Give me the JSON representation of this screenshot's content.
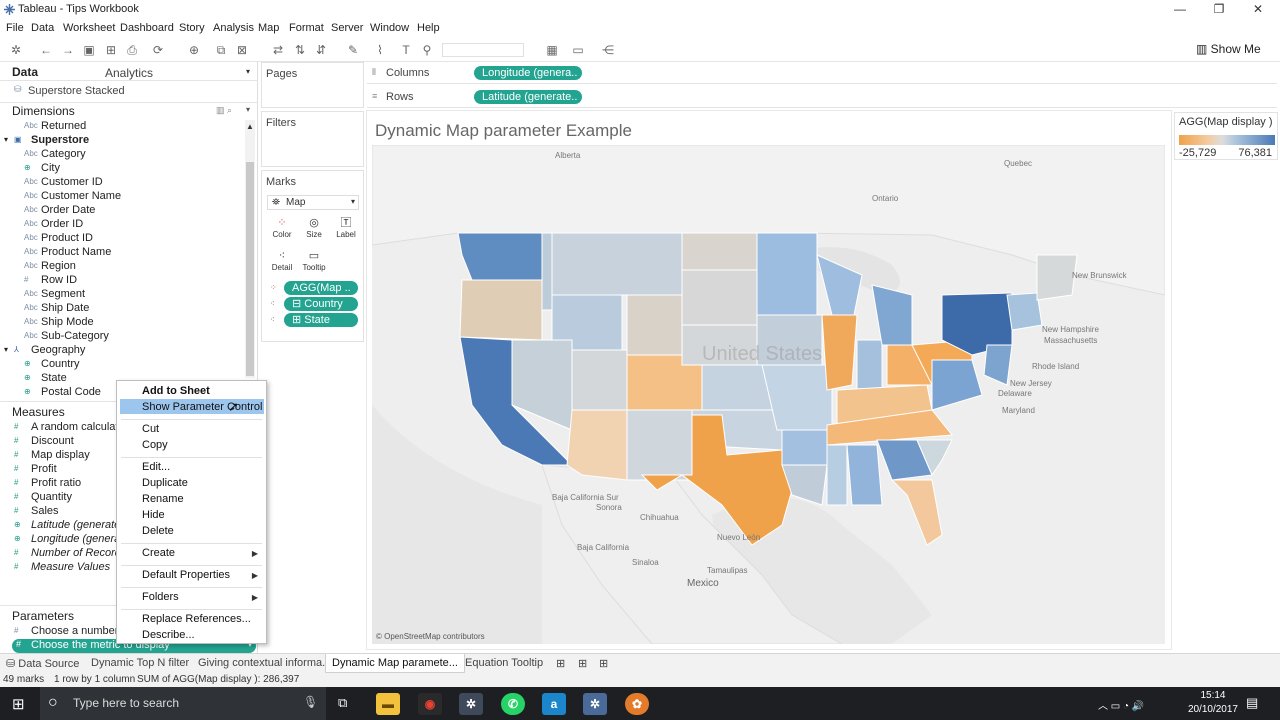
{
  "window": {
    "title": "Tableau - Tips Workbook",
    "controls": [
      "—",
      "❐",
      "✕"
    ]
  },
  "menu": [
    "File",
    "Data",
    "Worksheet",
    "Dashboard",
    "Story",
    "Analysis",
    "Map",
    "Format",
    "Server",
    "Window",
    "Help"
  ],
  "toolbar": {
    "show_me": "Show Me"
  },
  "data_pane": {
    "tabs": [
      "Data",
      "Analytics"
    ],
    "datasource": "Superstore Stacked",
    "dimensions_label": "Dimensions",
    "dimensions": [
      {
        "type": "Abc",
        "name": "Returned",
        "geo": false
      },
      {
        "type": "folder",
        "name": "Superstore",
        "geo": false
      },
      {
        "type": "Abc",
        "name": "Category",
        "geo": false
      },
      {
        "type": "geo",
        "name": "City",
        "geo": true
      },
      {
        "type": "Abc",
        "name": "Customer ID",
        "geo": false
      },
      {
        "type": "Abc",
        "name": "Customer Name",
        "geo": false
      },
      {
        "type": "Abc",
        "name": "Order Date",
        "geo": false
      },
      {
        "type": "Abc",
        "name": "Order ID",
        "geo": false
      },
      {
        "type": "Abc",
        "name": "Product ID",
        "geo": false
      },
      {
        "type": "Abc",
        "name": "Product Name",
        "geo": false
      },
      {
        "type": "Abc",
        "name": "Region",
        "geo": false
      },
      {
        "type": "#",
        "name": "Row ID",
        "geo": false
      },
      {
        "type": "Abc",
        "name": "Segment",
        "geo": false
      },
      {
        "type": "Abc",
        "name": "Ship Date",
        "geo": false
      },
      {
        "type": "Abc",
        "name": "Ship Mode",
        "geo": false
      },
      {
        "type": "Abc",
        "name": "Sub-Category",
        "geo": false
      },
      {
        "type": "hier",
        "name": "Geography",
        "geo": false
      },
      {
        "type": "geo",
        "name": "Country",
        "geo": true
      },
      {
        "type": "geo",
        "name": "State",
        "geo": true
      },
      {
        "type": "geo",
        "name": "Postal Code",
        "geo": true
      }
    ],
    "measures_label": "Measures",
    "measures": [
      {
        "name": "A random calculati",
        "italic": false
      },
      {
        "name": "Discount",
        "italic": false
      },
      {
        "name": "Map display",
        "italic": false
      },
      {
        "name": "Profit",
        "italic": false
      },
      {
        "name": "Profit ratio",
        "italic": false
      },
      {
        "name": "Quantity",
        "italic": false
      },
      {
        "name": "Sales",
        "italic": false
      },
      {
        "name": "Latitude (generate",
        "italic": true
      },
      {
        "name": "Longitude (genera",
        "italic": true
      },
      {
        "name": "Number of Record",
        "italic": true
      },
      {
        "name": "Measure Values",
        "italic": true
      }
    ],
    "parameters_label": "Parameters",
    "parameters": [
      "Choose a number o",
      "Choose the metric to display"
    ]
  },
  "cards": {
    "pages": "Pages",
    "filters": "Filters",
    "marks": "Marks",
    "mark_type": "Map",
    "mark_buttons": [
      "Color",
      "Size",
      "Label",
      "Detail",
      "Tooltip"
    ],
    "mark_pills": [
      "AGG(Map ..",
      "Country",
      "State"
    ]
  },
  "shelves": {
    "columns_label": "Columns",
    "columns_pill": "Longitude (genera..",
    "rows_label": "Rows",
    "rows_pill": "Latitude (generate.."
  },
  "viz": {
    "title": "Dynamic Map parameter Example",
    "credit": "© OpenStreetMap contributors",
    "places": [
      "Alberta",
      "Quebec",
      "Ontario",
      "New Brunswick",
      "New Hampshire",
      "Massachusetts",
      "Rhode Island",
      "New Jersey",
      "Delaware",
      "Maryland",
      "United States",
      "Baja California Sur",
      "Sonora",
      "Chihuahua",
      "Baja California",
      "Mexico",
      "Tamaulipas",
      "Nuevo León",
      "Sinaloa"
    ]
  },
  "legend": {
    "title": "AGG(Map display )",
    "min": "-25,729",
    "max": "76,381"
  },
  "context_menu": {
    "items": [
      "Add to Sheet",
      "Show Parameter Control",
      "Cut",
      "Copy",
      "Edit...",
      "Duplicate",
      "Rename",
      "Hide",
      "Delete",
      "Create",
      "Default Properties",
      "Folders",
      "Replace References...",
      "Describe..."
    ],
    "highlighted": "Show Parameter Control"
  },
  "sheet_tabs": [
    "Data Source",
    "Dynamic Top N filter",
    "Giving contextual informa...",
    "Dynamic Map paramete...",
    "Equation Tooltip"
  ],
  "active_tab": "Dynamic Map paramete...",
  "status": {
    "marks": "49 marks",
    "rowscols": "1 row by 1 column",
    "sum": "SUM of AGG(Map display ): 286,397"
  },
  "taskbar": {
    "search_placeholder": "Type here to search",
    "time": "15:14",
    "date": "20/10/2017"
  },
  "colors": {
    "accent_pill": "#23a491",
    "low": "#f0a24a",
    "high": "#4a79b5",
    "highlight": "#9dc6ef"
  }
}
